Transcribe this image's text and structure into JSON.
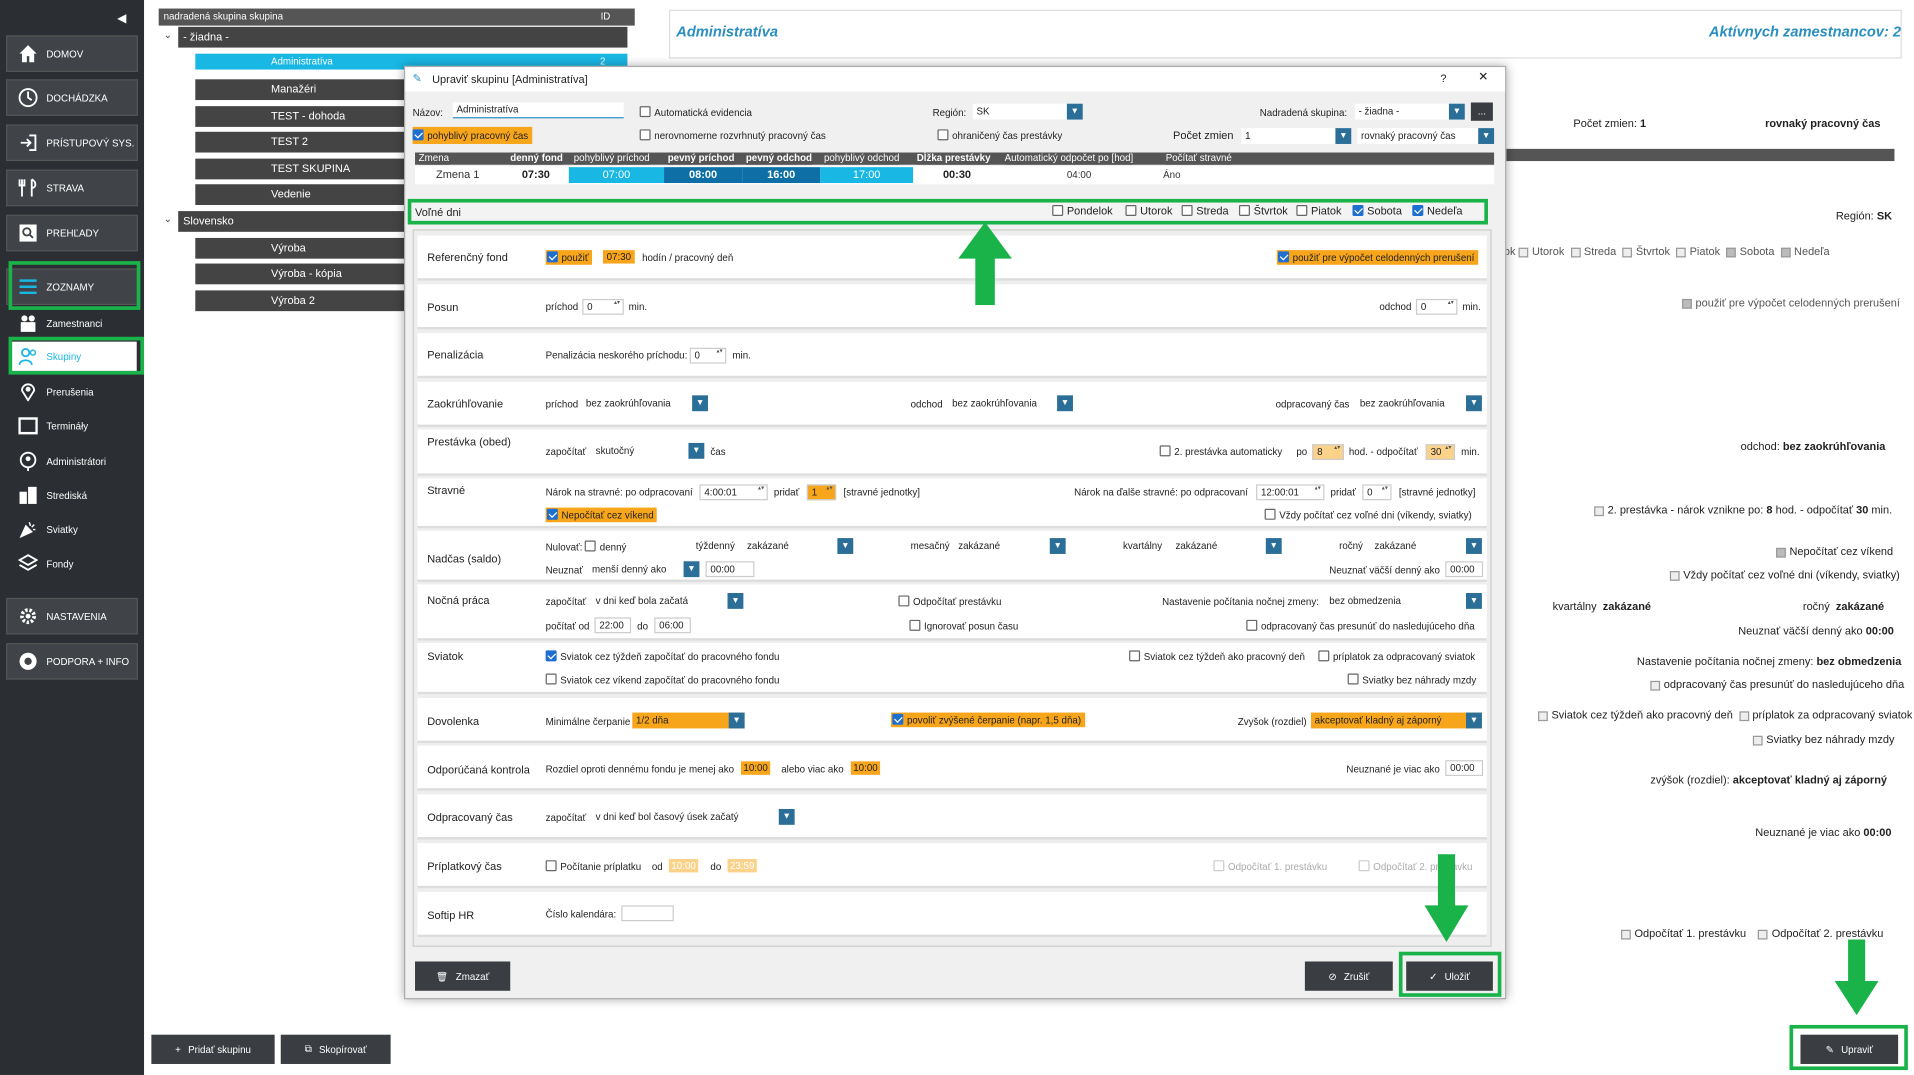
{
  "sidebar": {
    "collapse_icon": "◀",
    "nav": [
      {
        "label": "DOMOV",
        "icon": "home-icon"
      },
      {
        "label": "DOCHÁDZKA",
        "icon": "clock-icon"
      },
      {
        "label": "PRÍSTUPOVÝ SYS.",
        "icon": "door-icon"
      },
      {
        "label": "STRAVA",
        "icon": "cutlery-icon"
      },
      {
        "label": "PREHĽADY",
        "icon": "search-icon"
      },
      {
        "label": "ZOZNAMY",
        "icon": "list-icon"
      }
    ],
    "sub": [
      {
        "label": "Zamestnanci",
        "icon": "people-icon"
      },
      {
        "label": "Skupiny",
        "icon": "group-icon"
      },
      {
        "label": "Prerušenia",
        "icon": "pin-icon"
      },
      {
        "label": "Termináły",
        "icon": "terminal-icon"
      },
      {
        "label": "Administrátori",
        "icon": "admin-icon"
      },
      {
        "label": "Strediská",
        "icon": "building-icon"
      },
      {
        "label": "Sviatky",
        "icon": "party-icon"
      },
      {
        "label": "Fondy",
        "icon": "layers-icon"
      }
    ],
    "bottom": [
      {
        "label": "NASTAVENIA",
        "icon": "gear-icon"
      },
      {
        "label": "PODPORA + INFO",
        "icon": "lifebuoy-icon"
      }
    ]
  },
  "tree": {
    "header_left": "nadradená skupina  skupina",
    "header_right": "ID",
    "nodes": [
      "- žiadna -",
      "Administratíva",
      "Manažéri",
      "TEST - dohoda",
      "TEST 2",
      "TEST SKUPINA",
      "Vedenie",
      "Slovensko",
      "Výroba",
      "Výroba - kópia",
      "Výroba 2"
    ],
    "selected_id": "2",
    "add_button": "Pridať skupinu",
    "copy_button": "Skopírovať"
  },
  "right": {
    "title": "Administratíva",
    "active": "Aktívnych zamestnancov: 2",
    "shifts_label": "Počet zmien:",
    "shifts_value": "1",
    "even_time": "rovnaký pracovný čas",
    "region_label": "Región:",
    "region_value": "SK",
    "days": [
      "ok",
      "Utorok",
      "Streda",
      "Štvrtok",
      "Piatok",
      "Sobota",
      "Nedeľa"
    ],
    "use_full": "použiť pre výpočet celodenných prerušení",
    "departure_label": "odchod:",
    "departure_value": "bez zaokrúhľovania",
    "second_break": "2. prestávka - nárok vznikne po:",
    "second_break_hours": "8",
    "second_break_mid": "hod. - odpočítať",
    "second_break_min": "30",
    "second_break_unit": "min.",
    "no_weekend": "Nepočítať cez víkend",
    "always_free": "Vždy počítať cez voľné dni (víkendy, sviatky)",
    "quarterly_label": "kvartálny",
    "quarterly_value": "zakázané",
    "yearly_label": "ročný",
    "yearly_value": "zakázané",
    "neuznat": "Neuznať väčší denný ako",
    "neuznat_value": "00:00",
    "night_label": "Nastavenie počítania nočnej zmeny:",
    "night_value": "bez obmedzenia",
    "night_move": "odpracovaný čas presunúť do nasledujúceho dňa",
    "holiday_week": "Sviatok cez týždeň ako pracovný deň",
    "holiday_bonus": "príplatok za odpracovaný sviatok",
    "holiday_nocomp": "Sviatky bez náhrady mzdy",
    "increase_label": "zvýšok (rozdiel):",
    "increase_value": "akceptovať kladný aj záporný",
    "notover_label": "Neuznané je viac ako",
    "notover_value": "00:00",
    "deduct1": "Odpočítať 1. prestávku",
    "deduct2": "Odpočítať 2. prestávku",
    "edit_button": "Upraviť"
  },
  "dialog": {
    "title": "Upraviť skupinu [Administratíva]",
    "help": "?",
    "close": "✕",
    "name_label": "Názov:",
    "name_value": "Administratíva",
    "auto_evid": "Automatická evidencia",
    "region_label": "Región:",
    "region_value": "SK",
    "parent_label": "Nadradená skupina:",
    "parent_value": "- žiadna -",
    "more": "...",
    "flex": "pohyblivý pracovný čas",
    "uneven": "nerovnomerne rozvrhnutý pracovný čas",
    "limited": "ohraničený čas prestávky",
    "shifts_label": "Počet zmien",
    "shifts_value": "1",
    "even_value": "rovnaký pracovný čas",
    "shift_headers": [
      "Zmena",
      "denný fond",
      "pohyblivý príchod",
      "pevný príchod",
      "pevný odchod",
      "pohyblivý odchod",
      "Dĺžka prestávky",
      "Automatický odpočet po [hod]",
      "Počítať stravné"
    ],
    "shift_row": [
      "Zmena 1",
      "07:30",
      "07:00",
      "08:00",
      "16:00",
      "17:00",
      "00:30",
      "04:00",
      "Áno"
    ],
    "free_days_label": "Voľné dni",
    "days": [
      {
        "label": "Pondelok",
        "on": false
      },
      {
        "label": "Utorok",
        "on": false
      },
      {
        "label": "Streda",
        "on": false
      },
      {
        "label": "Štvrtok",
        "on": false
      },
      {
        "label": "Piatok",
        "on": false
      },
      {
        "label": "Sobota",
        "on": true
      },
      {
        "label": "Nedeľa",
        "on": true
      }
    ],
    "ref": {
      "title": "Referenčný fond",
      "use": "použiť",
      "hours": "07:30",
      "unit": "hodín / pracovný deň",
      "full": "použiť pre výpočet celodenných prerušení"
    },
    "posun": {
      "title": "Posun",
      "arr_label": "príchod",
      "arr": "0",
      "min": "min.",
      "dep_label": "odchod",
      "dep": "0"
    },
    "pen": {
      "title": "Penalizácia",
      "label": "Penalizácia neskorého príchodu:",
      "value": "0",
      "min": "min."
    },
    "round": {
      "title": "Zaokrúhľovanie",
      "arr_label": "príchod",
      "arr": "bez zaokrúhľovania",
      "dep_label": "odchod",
      "dep": "bez zaokrúhľovania",
      "work_label": "odpracovaný čas",
      "work": "bez zaokrúhľovania"
    },
    "brk": {
      "title": "Prestávka (obed)",
      "count_label": "započítať",
      "count": "skutočný",
      "time": "čas",
      "auto2": "2. prestávka automaticky",
      "after": "po",
      "h": "8",
      "hod": "hod. - odpočítať",
      "m": "30",
      "min": "min."
    },
    "meal": {
      "title": "Stravné",
      "label1": "Nárok na stravné: po odpracovaní",
      "t1": "4:00:01",
      "add": "pridať",
      "n1": "1",
      "units": "[stravné jednotky]",
      "nowknd": "Nepočítať cez víkend",
      "label2": "Nárok na ďalše stravné: po odpracovaní",
      "t2": "12:00:01",
      "n2": "0",
      "always": "Vždy počítať cez voľné dni (víkendy, sviatky)"
    },
    "ot": {
      "title": "Nadčas (saldo)",
      "reset": "Nulovať:",
      "daily": "denný",
      "weekly_label": "týždenný",
      "weekly": "zakázané",
      "monthly_label": "mesačný",
      "monthly": "zakázané",
      "q_label": "kvartálny",
      "q": "zakázané",
      "y_label": "ročný",
      "y": "zakázané",
      "neuz_label": "Neuznať",
      "neuz": "menší denný ako",
      "neuz_t": "00:00",
      "bigger": "Neuznať väčší denný ako",
      "bigger_t": "00:00"
    },
    "night": {
      "title": "Nočná práca",
      "count_label": "započítať",
      "count": "v dni keď bola začatá",
      "deduct": "Odpočítať prestávku",
      "setting_label": "Nastavenie počítania nočnej zmeny:",
      "setting": "bez obmedzenia",
      "from_label": "počítať od",
      "from": "22:00",
      "to_label": "do",
      "to": "06:00",
      "ignore": "Ignorovať posun času",
      "move": "odpracovaný čas presunúť do nasledujúceho dňa"
    },
    "hol": {
      "title": "Sviatok",
      "a": "Sviatok cez týždeň započítať do pracovného fondu",
      "b": "Sviatok cez víkend započítať do pracovného fondu",
      "c": "Sviatok cez týždeň ako pracovný deň",
      "d": "príplatok za odpracovaný sviatok",
      "e": "Sviatky bez náhrady mzdy"
    },
    "vac": {
      "title": "Dovolenka",
      "min_label": "Minimálne čerpanie",
      "min": "1/2 dňa",
      "allow": "povoliť zvýšené čerpanie (napr. 1,5 dňa)",
      "rest_label": "Zvyšok (rozdiel)",
      "rest": "akceptovať kladný aj záporný"
    },
    "rec": {
      "title": "Odporúčaná kontrola",
      "diff": "Rozdiel oproti dennému fondu je menej ako",
      "a": "10:00",
      "or": "alebo viac ako",
      "b": "10:00",
      "notover": "Neuznané je viac ako",
      "c": "00:00"
    },
    "worked": {
      "title": "Odpracovaný čas",
      "label": "započítať",
      "value": "v dni keď bol časový úsek začatý"
    },
    "bonus": {
      "title": "Príplatkový čas",
      "label": "Počítanie príplatku",
      "from_label": "od",
      "from": "10:00",
      "to_label": "do",
      "to": "23:59",
      "d1": "Odpočítať 1. prestávku",
      "d2": "Odpočítať 2. prestávku"
    },
    "softip": {
      "title": "Softip HR",
      "label": "Číslo kalendára:",
      "value": ""
    },
    "delete": "Zmazať",
    "cancel": "Zrušiť",
    "save": "Uložiť"
  },
  "colors": {
    "accent": "#19b7e4",
    "highlight": "#1ab34a",
    "orange": "#f7a51b",
    "sidebar": "#2b2f33"
  }
}
